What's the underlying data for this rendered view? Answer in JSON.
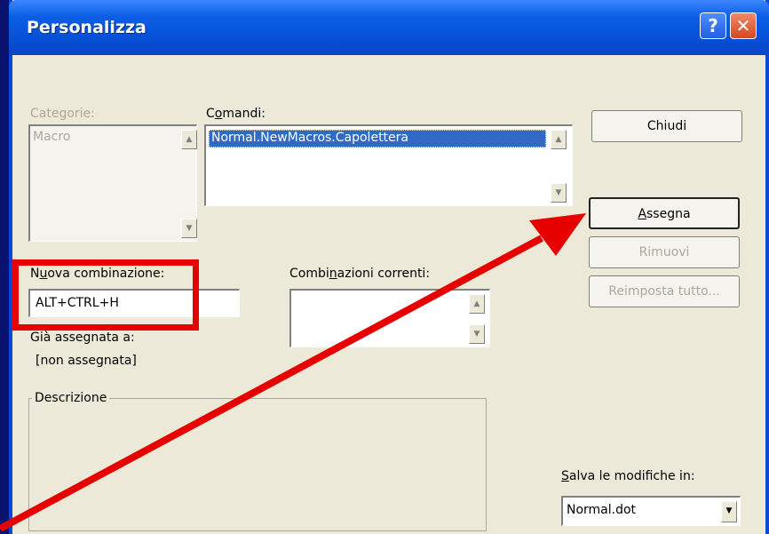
{
  "window": {
    "title": "Personalizza",
    "help_icon": "?",
    "close_icon": "✕"
  },
  "categories": {
    "label": "Categorie:",
    "items": [
      "Macro"
    ]
  },
  "commands": {
    "label_pre": "C",
    "label_u": "o",
    "label_post": "mandi:",
    "items": [
      "Normal.NewMacros.Capolettera"
    ]
  },
  "buttons": {
    "close": "Chiudi",
    "assign_u": "A",
    "assign_rest": "ssegna",
    "remove": "Rimuovi",
    "reset_all": "Reimposta tutto..."
  },
  "new_combination": {
    "label_pre": "N",
    "label_u": "u",
    "label_post": "ova combinazione:",
    "value": "ALT+CTRL+H"
  },
  "current_combinations": {
    "label_pre": "Combi",
    "label_u": "n",
    "label_post": "azioni correnti:"
  },
  "assigned_to": {
    "label": "Già assegnata a:",
    "value": "[non assegnata]"
  },
  "description": {
    "label": "Descrizione"
  },
  "save_in": {
    "label_u": "S",
    "label_rest": "alva le modifiche in:",
    "value": "Normal.dot"
  },
  "annotation_color": "#e60000"
}
